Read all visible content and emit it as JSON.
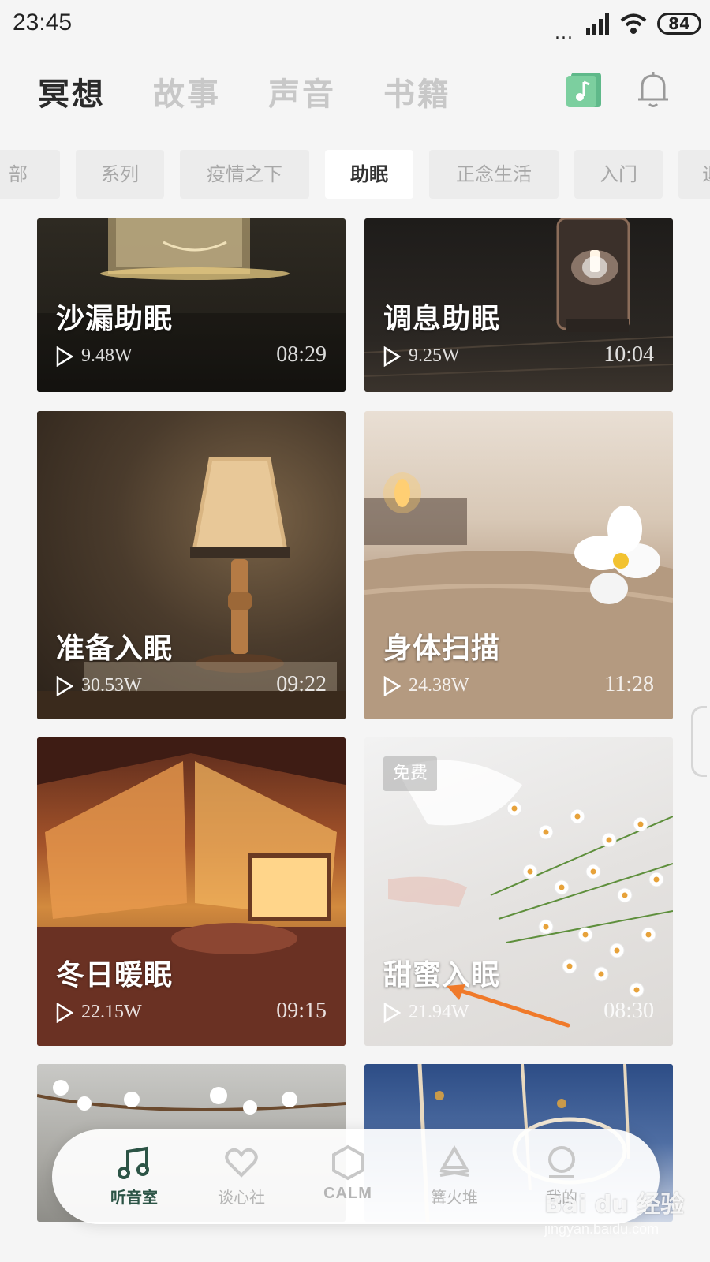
{
  "status_bar": {
    "time": "23:45",
    "dots": "...",
    "battery": "84"
  },
  "header": {
    "tabs": [
      {
        "label": "冥想",
        "active": true
      },
      {
        "label": "故事",
        "active": false
      },
      {
        "label": "声音",
        "active": false
      },
      {
        "label": "书籍",
        "active": false
      }
    ],
    "icons": [
      "music-note-icon",
      "bell-icon"
    ]
  },
  "categories": {
    "items": [
      {
        "label": "部",
        "active": false
      },
      {
        "label": "系列",
        "active": false
      },
      {
        "label": "疫情之下",
        "active": false
      },
      {
        "label": "助眠",
        "active": true
      },
      {
        "label": "正念生活",
        "active": false
      },
      {
        "label": "入门",
        "active": false
      },
      {
        "label": "退",
        "active": false
      }
    ]
  },
  "cards": [
    {
      "title": "沙漏助眠",
      "plays": "9.48W",
      "duration": "08:29",
      "free": false
    },
    {
      "title": "调息助眠",
      "plays": "9.25W",
      "duration": "10:04",
      "free": false
    },
    {
      "title": "准备入眠",
      "plays": "30.53W",
      "duration": "09:22",
      "free": false
    },
    {
      "title": "身体扫描",
      "plays": "24.38W",
      "duration": "11:28",
      "free": false
    },
    {
      "title": "冬日暖眠",
      "plays": "22.15W",
      "duration": "09:15",
      "free": false
    },
    {
      "title": "甜蜜入眠",
      "plays": "21.94W",
      "duration": "08:30",
      "free": true,
      "badge": "免费"
    }
  ],
  "bottom_nav": {
    "items": [
      {
        "label": "听音室",
        "icon": "music-note-icon",
        "active": true
      },
      {
        "label": "谈心社",
        "icon": "heart-icon",
        "active": false
      },
      {
        "label": "CALM",
        "icon": "hexagon-icon",
        "active": false
      },
      {
        "label": "篝火堆",
        "icon": "campfire-icon",
        "active": false
      },
      {
        "label": "我的",
        "icon": "profile-icon",
        "active": false
      }
    ]
  },
  "watermark": {
    "text": "Bai du 经验",
    "sub": "jingyan.baidu.com"
  },
  "colors": {
    "accent": "#2c5446",
    "annotation_arrow": "#f07a2a",
    "background": "#f5f5f5"
  }
}
